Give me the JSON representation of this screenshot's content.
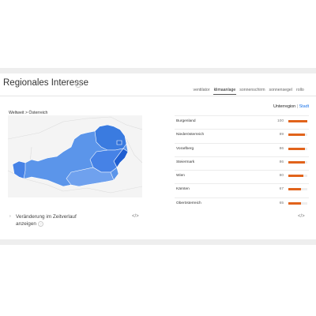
{
  "section": {
    "title": "Regionales Interesse",
    "tabs": [
      {
        "label": "ventilator",
        "active": false
      },
      {
        "label": "klimaanlage",
        "active": true
      },
      {
        "label": "sonnenschirm",
        "active": false
      },
      {
        "label": "sonnensegel",
        "active": false
      },
      {
        "label": "rollo",
        "active": false
      }
    ]
  },
  "map": {
    "breadcrumb": "Weltweit > Österreich",
    "fill_color": "#4d8be8",
    "highlight_color": "#2f6fd6"
  },
  "regions": {
    "toggle_selected": "Unterregion",
    "toggle_separator": "|",
    "toggle_other": "Stadt",
    "bar_color": "#e1631b",
    "rows": [
      {
        "name": "Burgenland",
        "value": "100",
        "fraction": 1.0
      },
      {
        "name": "Niederösterreich",
        "value": "89",
        "fraction": 0.89
      },
      {
        "name": "Vorarlberg",
        "value": "86",
        "fraction": 0.86
      },
      {
        "name": "Steiermark",
        "value": "86",
        "fraction": 0.86
      },
      {
        "name": "Wien",
        "value": "80",
        "fraction": 0.8
      },
      {
        "name": "Kärnten",
        "value": "67",
        "fraction": 0.67
      },
      {
        "name": "Oberösterreich",
        "value": "65",
        "fraction": 0.65
      }
    ]
  },
  "footer": {
    "expand_line1": "Veränderung im Zeitverlauf",
    "expand_line2": "anzeigen",
    "embed_icon": "code-embed-icon"
  }
}
